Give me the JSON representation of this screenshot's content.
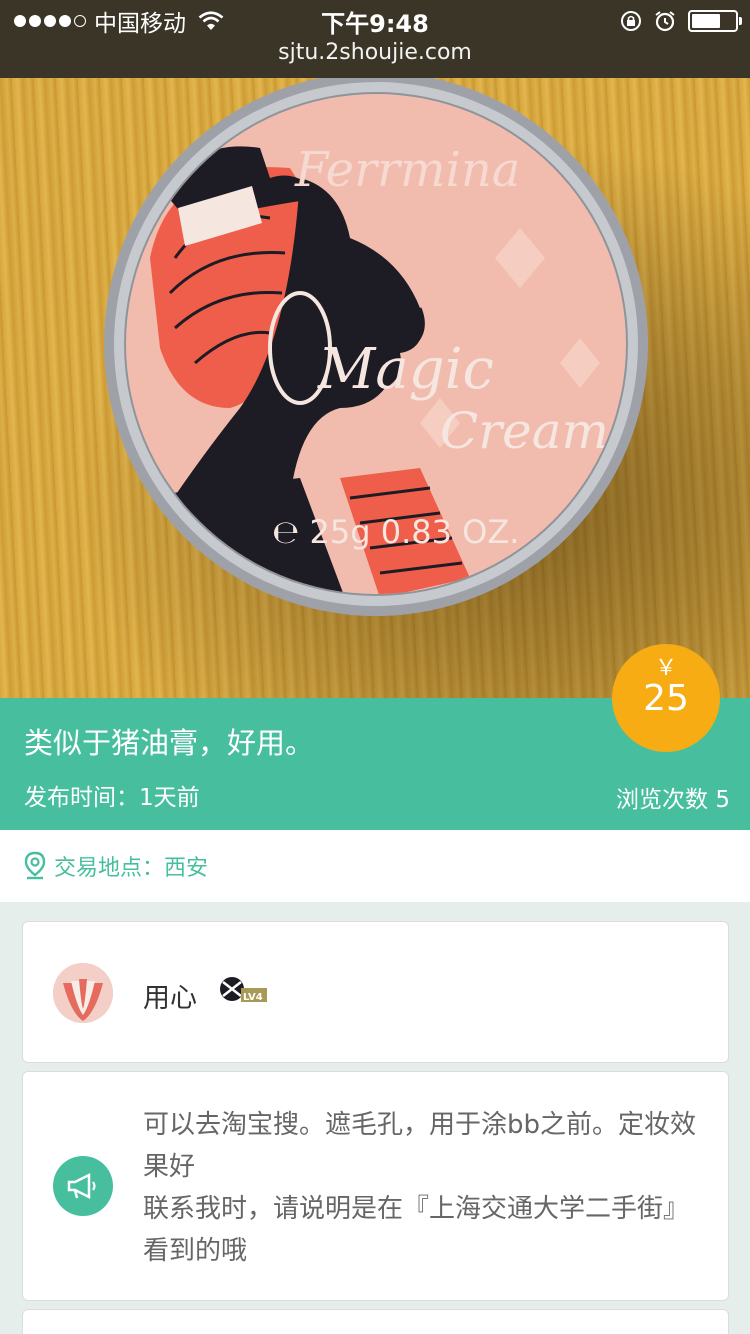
{
  "status_bar": {
    "carrier": "中国移动",
    "time": "下午9:48",
    "url": "sjtu.2shoujie.com"
  },
  "hero": {
    "product_text": {
      "brand": "Ferrmina",
      "line1": "Magic",
      "line2": "Cream",
      "weight": "℮ 25g 0.83 OZ."
    },
    "carousel": {
      "count": 3,
      "active": 1
    }
  },
  "item": {
    "title": "类似于猪油膏，好用。",
    "published": "发布时间：1天前",
    "views": "浏览次数 5",
    "price_symbol": "￥",
    "price": "25"
  },
  "location": {
    "text": "交易地点：西安"
  },
  "seller": {
    "name": "用心",
    "level": "LV4"
  },
  "description": {
    "line1": "可以去淘宝搜。遮毛孔，用于涂bb之前。定妆效果好",
    "line2": "联系我时，请说明是在『上海交通大学二手街』看到的哦"
  },
  "colors": {
    "accent_green": "#47bf9e",
    "price_orange": "#f7ac14",
    "status_bar": "#3b3527",
    "background": "#e6eeec"
  },
  "icons": [
    "wifi-icon",
    "rotation-lock-icon",
    "alarm-icon",
    "battery-icon",
    "location-pin-icon",
    "megaphone-icon",
    "level-badge-icon"
  ]
}
